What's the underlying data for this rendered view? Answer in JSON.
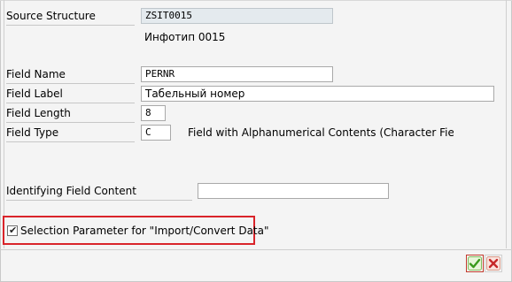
{
  "source_structure": {
    "label": "Source Structure",
    "value": "ZSIT0015",
    "description": "Инфотип 0015"
  },
  "field_name": {
    "label": "Field Name",
    "value": "PERNR"
  },
  "field_label": {
    "label": "Field Label",
    "value": "Табельный номер"
  },
  "field_length": {
    "label": "Field Length",
    "value": "8"
  },
  "field_type": {
    "label": "Field Type",
    "value": "C",
    "description": "Field with Alphanumerical Contents (Character Fiel..."
  },
  "identifying_content": {
    "label": "Identifying Field Content",
    "value": ""
  },
  "selection_parameter": {
    "label": "Selection Parameter for \"Import/Convert Data\"",
    "checked": true
  },
  "buttons": {
    "ok_icon": "checkmark-icon",
    "cancel_icon": "close-icon"
  },
  "colors": {
    "highlight": "#d9242a",
    "ok_green": "#4caf1f",
    "cancel_red": "#c62828"
  }
}
